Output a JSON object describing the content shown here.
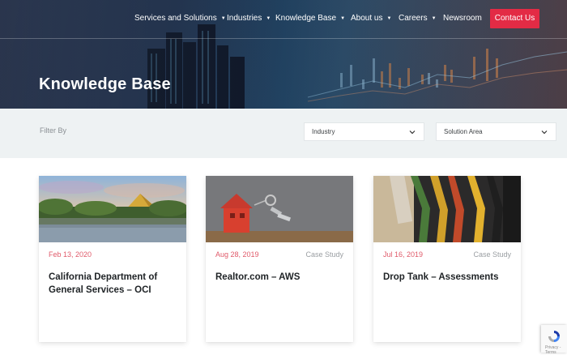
{
  "nav": {
    "items": [
      {
        "label": "Services and Solutions",
        "dropdown": true
      },
      {
        "label": "Industries",
        "dropdown": true
      },
      {
        "label": "Knowledge Base",
        "dropdown": true
      },
      {
        "label": "About us",
        "dropdown": true
      },
      {
        "label": "Careers",
        "dropdown": true
      },
      {
        "label": "Newsroom",
        "dropdown": false
      }
    ],
    "contact_label": "Contact Us",
    "caret": "▼"
  },
  "hero": {
    "title": "Knowledge Base"
  },
  "filters": {
    "label": "Filter By",
    "industry": "Industry",
    "solution_area": "Solution Area"
  },
  "cards": [
    {
      "date": "Feb 13, 2020",
      "type": "",
      "title": "California Department of General Services – OCI"
    },
    {
      "date": "Aug 28, 2019",
      "type": "Case Study",
      "title": "Realtor.com – AWS"
    },
    {
      "date": "Jul 16, 2019",
      "type": "Case Study",
      "title": "Drop Tank – Assessments"
    }
  ],
  "recaptcha": {
    "footer": "Privacy - Terms"
  },
  "colors": {
    "accent": "#e32b45",
    "date": "#e05a6a",
    "filter_bg": "#eef2f3"
  }
}
